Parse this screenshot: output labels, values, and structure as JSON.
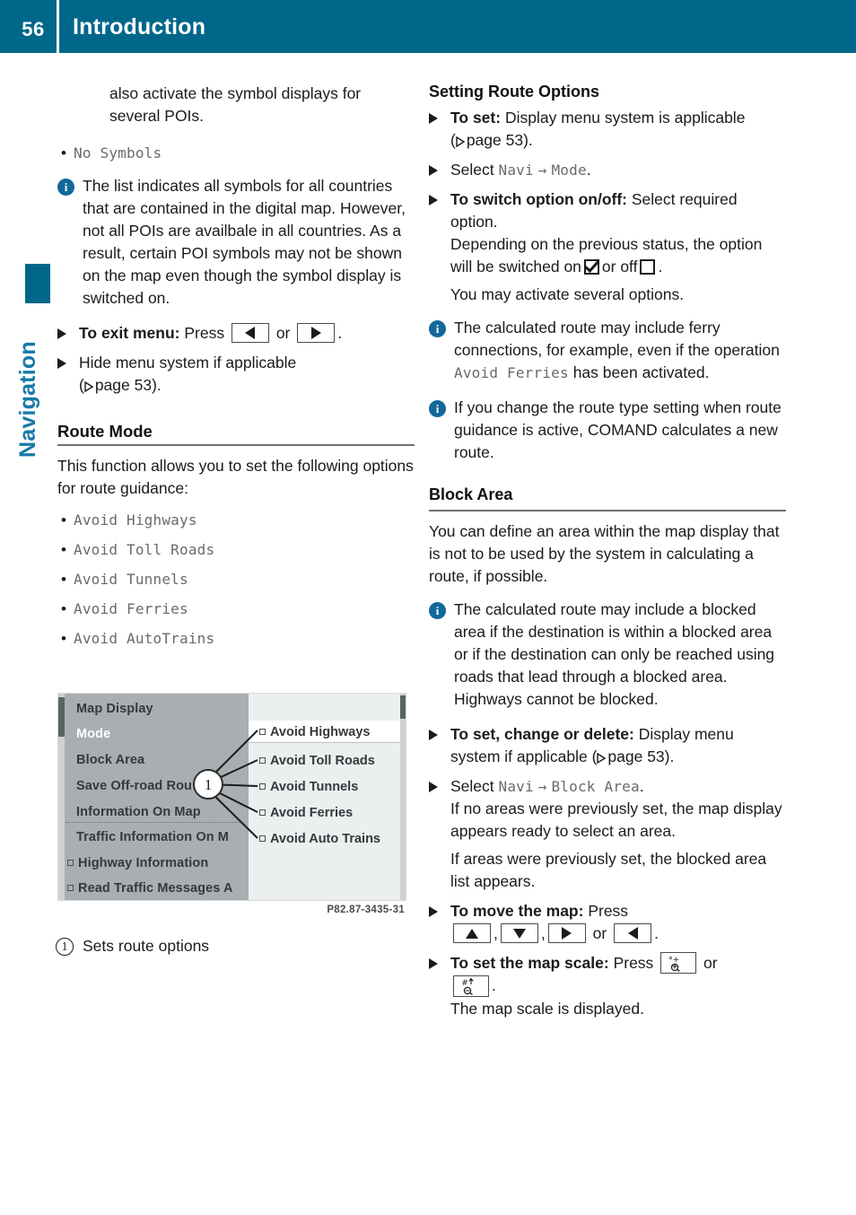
{
  "header": {
    "page_number": "56",
    "title": "Introduction"
  },
  "side_tab": {
    "label": "Navigation",
    "color": "#1679a8"
  },
  "left_column": {
    "continuation_paragraph": "also activate the symbol displays for several POIs.",
    "symbol_bullet": "No Symbols",
    "note_symbols": "The list indicates all symbols for all countries that are contained in the digital map. However, not all POIs are availbale in all countries. As a result, certain POI symbols may not be shown on the map even though the symbol display is switched on.",
    "step_exit_label": "To exit menu:",
    "step_exit_text": "Press",
    "step_exit_or": "or",
    "step_hide_text": "Hide menu system if applicable",
    "step_hide_ref_open": "(",
    "step_hide_ref": "page 53).",
    "route_mode": {
      "heading": "Route Mode",
      "intro": "This function allows you to set the following options for route guidance:",
      "options": [
        "Avoid Highways",
        "Avoid Toll Roads",
        "Avoid Tunnels",
        "Avoid Ferries",
        "Avoid AutoTrains"
      ]
    },
    "figure": {
      "image_code": "P82.87-3435-31",
      "callout_number": "1",
      "caption_number": "1",
      "caption_text": "Sets route options",
      "menu_items": [
        {
          "label": "Map Display",
          "selected": false,
          "checkbox": false
        },
        {
          "label": "Mode",
          "selected": true,
          "checkbox": false
        },
        {
          "label": "Block Area",
          "selected": false,
          "checkbox": false
        },
        {
          "label": "Save Off-road Rou",
          "selected": false,
          "checkbox": false
        },
        {
          "label": "Information On Map",
          "selected": false,
          "checkbox": false
        },
        {
          "label": "Traffic Information On M",
          "selected": false,
          "checkbox": false
        },
        {
          "label": "Highway Information",
          "selected": false,
          "checkbox": true
        },
        {
          "label": "Read Traffic Messages A",
          "selected": false,
          "checkbox": true
        }
      ],
      "submenu_items": [
        "Avoid Highways",
        "Avoid Toll Roads",
        "Avoid Tunnels",
        "Avoid Ferries",
        "Avoid Auto Trains"
      ]
    }
  },
  "right_column": {
    "setting_route_options": {
      "heading": "Setting Route Options",
      "step_set_label": "To set:",
      "step_set_text": "Display menu system is applicable",
      "step_set_ref_open": "(",
      "step_set_ref": "page 53).",
      "step_select_text": "Select",
      "step_select_path_a": "Navi",
      "step_select_arrow": "→",
      "step_select_path_b": "Mode",
      "step_select_end": ".",
      "step_switch_label": "To switch option on/off:",
      "step_switch_text": "Select required option.",
      "step_switch_line2_a": "Depending on the previous status, the option will be switched on",
      "step_switch_line2_b": "or off",
      "step_switch_line2_c": ".",
      "step_switch_line3": "You may activate several options.",
      "note_ferries_a": "The calculated route may include ferry connections, for example, even if the operation",
      "note_ferries_mono": "Avoid Ferries",
      "note_ferries_b": "has been activated.",
      "note_route_type": "If you change the route type setting when route guidance is active, COMAND calculates a new route."
    },
    "block_area": {
      "heading": "Block Area",
      "intro": "You can define an area within the map display that is not to be used by the system in calculating a route, if possible.",
      "note_blocked": "The calculated route may include a blocked area if the destination is within a blocked area or if the destination can only be reached using roads that lead through a blocked area. Highways cannot be blocked.",
      "step_set_label": "To set, change or delete:",
      "step_set_text": "Display menu system if applicable (",
      "step_set_ref": "page 53).",
      "step_select_text": "Select",
      "step_select_path_a": "Navi",
      "step_select_arrow": "→",
      "step_select_path_b": "Block Area",
      "step_select_end": ".",
      "step_select_sub1": "If no areas were previously set, the map display appears ready to select an area.",
      "step_select_sub2": "If areas were previously set, the blocked area list appears.",
      "step_move_label": "To move the map:",
      "step_move_text": "Press",
      "step_move_or": "or",
      "step_scale_label": "To set the map scale:",
      "step_scale_text": "Press",
      "step_scale_or": "or",
      "step_scale_sub": "The map scale is displayed."
    }
  },
  "icons": {
    "info": "info-icon",
    "arrow_left_key": "arrow-left-key-icon",
    "arrow_right_key": "arrow-right-key-icon",
    "arrow_up_key": "arrow-up-key-icon",
    "arrow_down_key": "arrow-down-key-icon",
    "zoom_in_key": "zoom-in-key-icon",
    "zoom_out_key": "zoom-out-key-icon",
    "checkbox_checked": "checkbox-checked-icon",
    "checkbox_unchecked": "checkbox-unchecked-icon"
  },
  "colors": {
    "brand_blue": "#00678a",
    "tab_blue": "#1679a8",
    "info_blue": "#11689a",
    "mono_gray": "#6a6a6a"
  }
}
